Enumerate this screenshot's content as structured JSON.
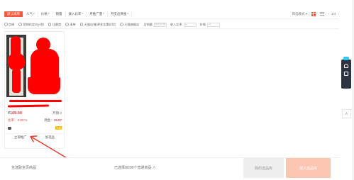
{
  "sort_tabs": [
    {
      "label": "默认排序",
      "active": true
    },
    {
      "label": "人气",
      "active": false
    },
    {
      "label": "价格",
      "active": false
    },
    {
      "label": "销量",
      "active": false
    },
    {
      "label": "收入比率",
      "active": false
    },
    {
      "label": "月推广量",
      "active": false
    },
    {
      "label": "月支出佣金",
      "active": false
    }
  ],
  "sort_select": {
    "label": "筛选模式"
  },
  "pager": {
    "text": "1/4"
  },
  "filters": [
    {
      "label": "包邮"
    },
    {
      "label": "营销机定向计划"
    },
    {
      "label": "比赛商"
    },
    {
      "label": "清单"
    },
    {
      "label": "天猫店铺(更多实惠好货)"
    },
    {
      "label": "天猫旗舰店"
    }
  ],
  "ranges": [
    {
      "label": "月销量",
      "placeholder": "最低价格"
    },
    {
      "label": "收入比率",
      "placeholder": "%"
    },
    {
      "label": "价格",
      "placeholder": "元"
    }
  ],
  "card": {
    "price_symbol": "¥",
    "price": "169.00",
    "sales": "月销 0",
    "rate_label": "比率：",
    "rate": "3.00 %",
    "earn_label": "佣金：",
    "earn_symbol": "¥",
    "earn": "5.07",
    "badge": "天猫",
    "action_left": "立即推广",
    "action_right": "加选品"
  },
  "bottom": {
    "left": "全选取全页商品",
    "count": "已选择0/200个普通商品 ∧",
    "clear": "我的选品库",
    "add": "加入选品库"
  },
  "backtop": "∧"
}
